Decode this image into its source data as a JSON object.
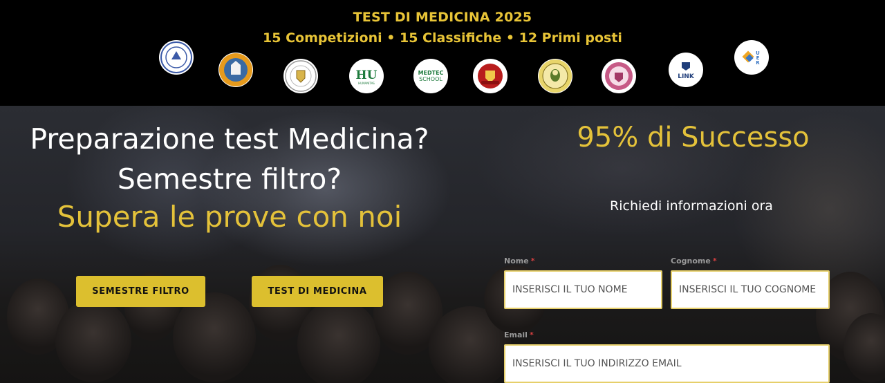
{
  "banner": {
    "title": "TEST DI MEDICINA 2025",
    "subtitle": "15 Competizioni • 15 Classifiche • 12 Primi posti",
    "logos": [
      {
        "name": "campus-bio-medico-logo-icon"
      },
      {
        "name": "university-seal-logo-icon"
      },
      {
        "name": "university-crest-logo-icon"
      },
      {
        "name": "humanitas-university-logo-icon",
        "text": "HU",
        "caption": "HUMANITAS UNIVERSITY"
      },
      {
        "name": "medtec-school-logo-icon",
        "text": "MEDTEC SCHOOL"
      },
      {
        "name": "red-crest-logo-icon"
      },
      {
        "name": "universitas-portrait-logo-icon"
      },
      {
        "name": "lum-university-logo-icon"
      },
      {
        "name": "link-university-logo-icon",
        "text": "LINK"
      },
      {
        "name": "uer-university-logo-icon",
        "text": "UER"
      }
    ]
  },
  "hero": {
    "headline_line1": "Preparazione test Medicina?",
    "headline_line2": "Semestre filtro?",
    "tagline": "Supera le prove con noi",
    "buttons": {
      "semestre_filtro": "SEMESTRE FILTRO",
      "test_medicina": "TEST DI MEDICINA"
    }
  },
  "form": {
    "success_heading": "95% di Successo",
    "request_text": "Richiedi informazioni ora",
    "nome_label": "Nome",
    "nome_placeholder": "INSERISCI IL TUO NOME",
    "cognome_label": "Cognome",
    "cognome_placeholder": "INSERISCI IL TUO COGNOME",
    "email_label": "Email",
    "email_placeholder": "INSERISCI IL TUO INDIRIZZO EMAIL",
    "required_marker": "*"
  },
  "colors": {
    "accent_gold": "#e4c23a",
    "button_gold": "#dcbf2e",
    "banner_bg": "#000000",
    "required_red": "#d64040"
  }
}
